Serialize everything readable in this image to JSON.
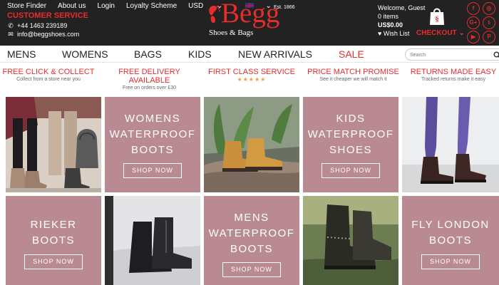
{
  "header": {
    "links": [
      "Store Finder",
      "About us",
      "Login",
      "Loyalty Scheme"
    ],
    "currency": "USD",
    "currency_caret": "⌄",
    "language_caret": "⌄",
    "customer_service": "CUSTOMER SERVICE",
    "phone": "+44 1463 239189",
    "email": "info@beggshoes.com",
    "logo": {
      "name": "Begg",
      "established": "Est. 1866",
      "subtitle": "Shoes & Bags"
    },
    "account": {
      "greeting": "Welcome, Guest",
      "items": "0 items",
      "total": "US$0.00",
      "wishlist": "Wish List",
      "checkout": "CHECKOUT"
    },
    "social_icons": [
      "facebook-icon",
      "instagram-icon",
      "google-plus-icon",
      "twitter-icon",
      "youtube-icon",
      "pinterest-icon"
    ],
    "social_glyphs": [
      "f",
      "◎",
      "G+",
      "t",
      "▶",
      "P"
    ]
  },
  "nav": {
    "items": [
      "MENS",
      "WOMENS",
      "BAGS",
      "KIDS",
      "NEW ARRIVALS",
      "SALE"
    ],
    "search_placeholder": "Search"
  },
  "usps": [
    {
      "title": "FREE CLICK & COLLECT",
      "subtitle": "Collect from a store near you"
    },
    {
      "title": "FREE DELIVERY AVAILABLE",
      "subtitle": "Free on orders over £30"
    },
    {
      "title": "FIRST CLASS SERVICE",
      "stars": "★★★★★"
    },
    {
      "title": "PRICE MATCH PROMISE",
      "subtitle": "See it cheaper we will match it"
    },
    {
      "title": "RETURNS MADE EASY",
      "subtitle": "Tracked returns make it easy"
    }
  ],
  "tiles": [
    {
      "lines": [
        "WOMENS",
        "WATERPROOF",
        "BOOTS"
      ],
      "button": "SHOP NOW"
    },
    {
      "lines": [
        "KIDS",
        "WATERPROOF",
        "SHOES"
      ],
      "button": "SHOP NOW"
    },
    {
      "lines": [
        "RIEKER",
        "BOOTS"
      ],
      "button": "SHOP NOW"
    },
    {
      "lines": [
        "MENS",
        "WATERPROOF",
        "BOOTS"
      ],
      "button": "SHOP NOW"
    },
    {
      "lines": [
        "FLY LONDON",
        "BOOTS"
      ],
      "button": "SHOP NOW"
    }
  ],
  "colors": {
    "brand_red": "#e62c2c",
    "tile_pink": "#b98a92",
    "topbar": "#222222",
    "star_gold": "#e7a23d"
  }
}
